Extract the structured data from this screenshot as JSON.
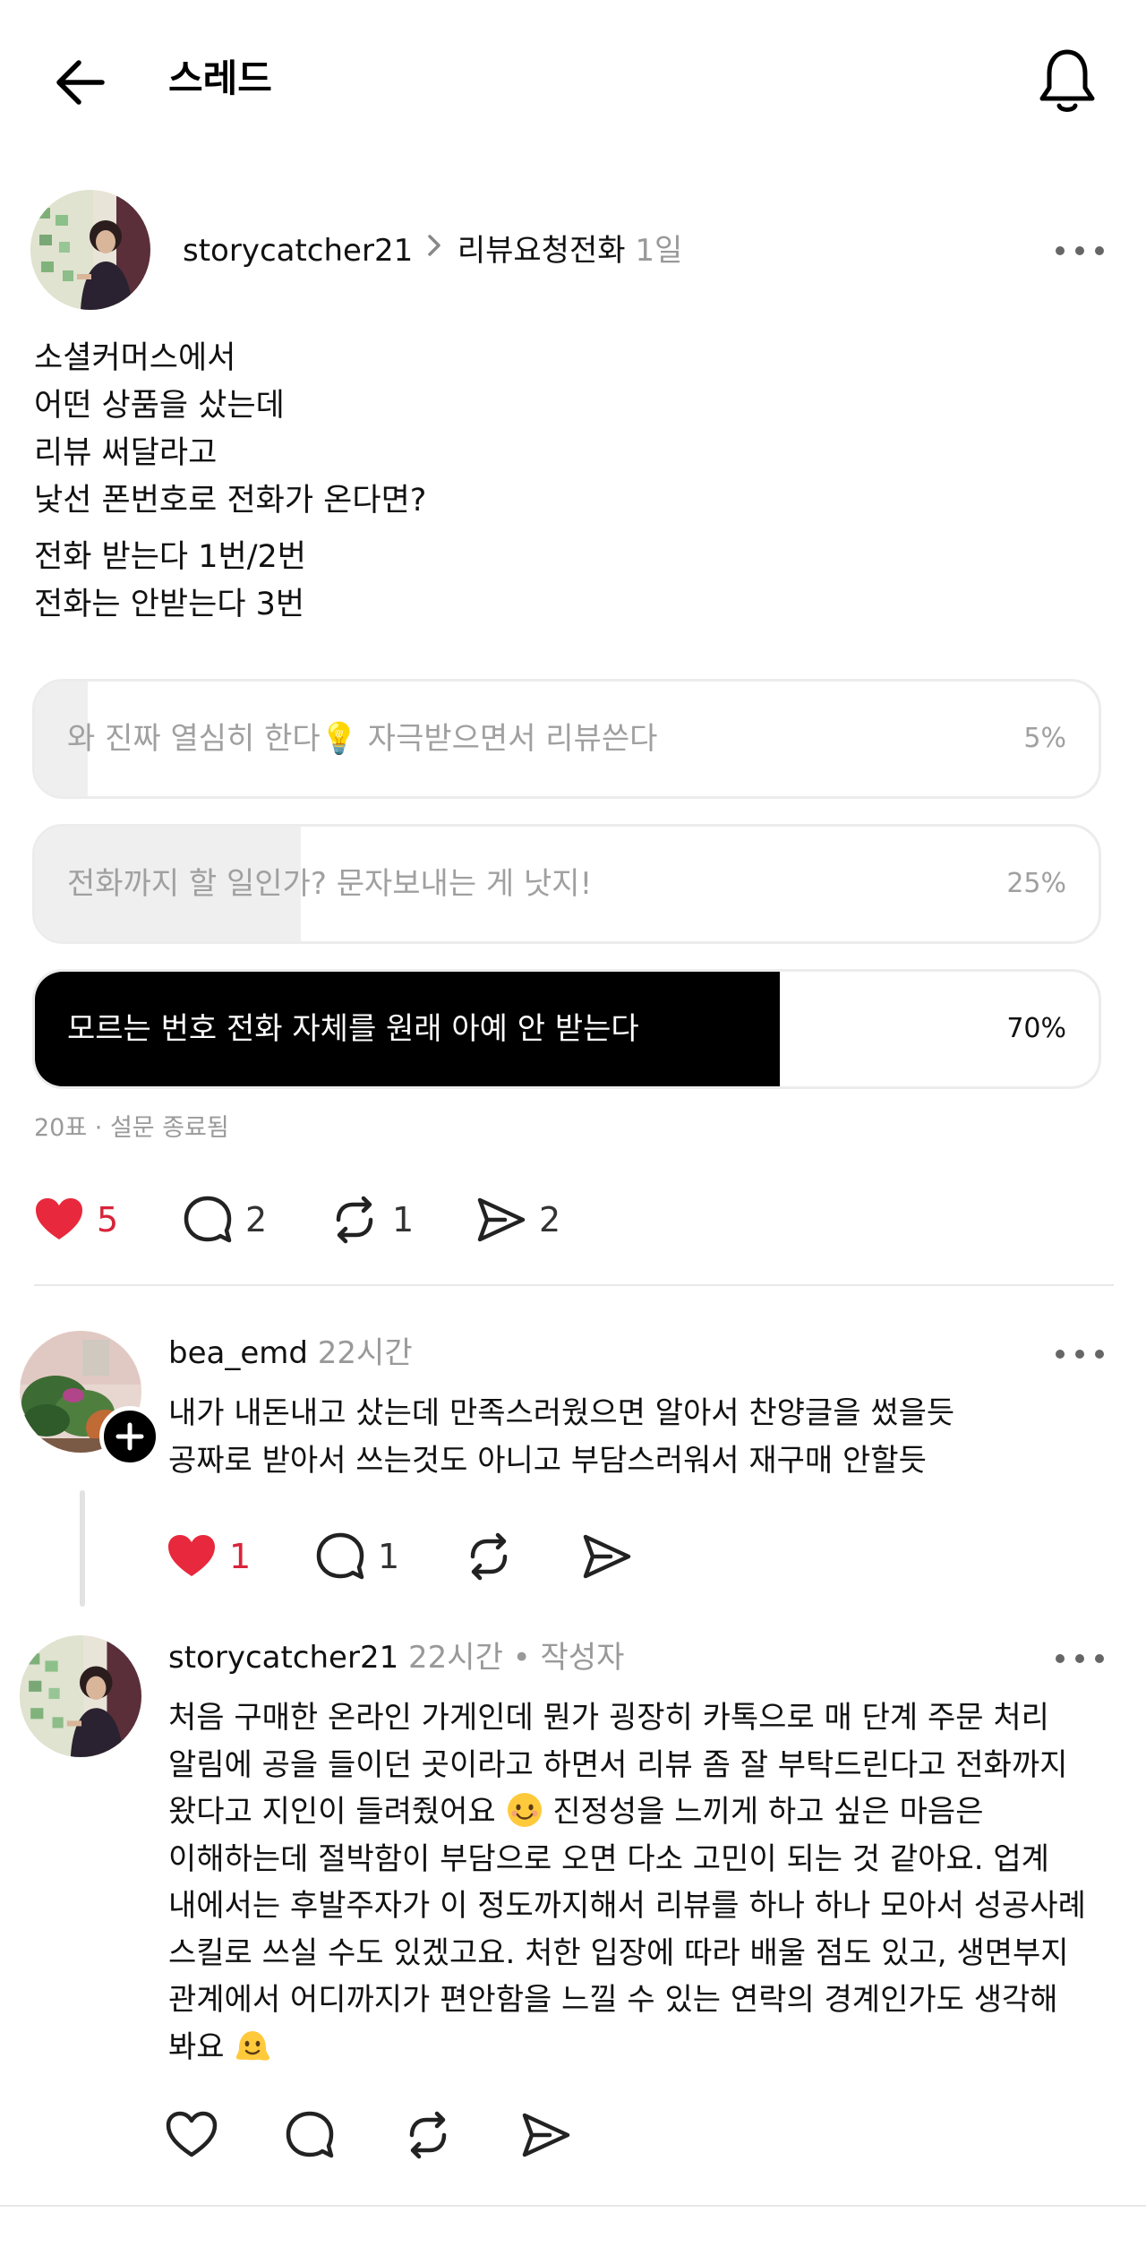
{
  "header": {
    "title": "스레드",
    "back_icon": "arrow-left-icon",
    "bell_icon": "bell-icon"
  },
  "post": {
    "author": "storycatcher21",
    "separator": ">",
    "topic": "리뷰요청전화",
    "time": "1일",
    "body_lines": [
      "소셜커머스에서",
      "어떤 상품을 샀는데",
      "리뷰 써달라고",
      "낯선 폰번호로 전화가 온다면?"
    ],
    "body_lines2": [
      "전화 받는다 1번/2번",
      "전화는 안받는다 3번"
    ],
    "poll": {
      "options": [
        {
          "label": "와 진짜 열심히 한다💡 자극받으면서 리뷰쓴다",
          "percent_label": "5%",
          "fraction": 0.05,
          "selected": false
        },
        {
          "label": "전화까지 할 일인가? 문자보내는 게 낫지!",
          "percent_label": "25%",
          "fraction": 0.25,
          "selected": false
        },
        {
          "label": "모르는 번호 전화 자체를 원래 아예 안 받는다",
          "percent_label": "70%",
          "fraction": 0.7,
          "selected": true
        }
      ],
      "summary": "20표 · 설문 종료됨"
    },
    "actions": {
      "likes": "5",
      "comments": "2",
      "reposts": "1",
      "shares": "2",
      "liked": true
    }
  },
  "replies": [
    {
      "author": "bea_emd",
      "time": "22시간",
      "lines": [
        "내가 내돈내고 샀는데 만족스러웠으면 알아서 찬양글을 썼을듯",
        "공짜로 받아서 쓰는것도 아니고 부담스러워서 재구매 안할듯"
      ],
      "likes": "1",
      "comments": "1",
      "liked": true
    },
    {
      "author": "storycatcher21",
      "time": "22시간",
      "author_badge": "• 작성자",
      "lines": [
        "처음 구매한 온라인 가게인데 뭔가 굉장히 카톡으로 매 단계 주문 처리",
        "알림에 공을 들이던 곳이라고 하면서 리뷰 좀 잘 부탁드린다고 전화까지",
        "왔다고 지인이 들려줬어요",
        "진정성을 느끼게 하고 싶은 마음은",
        "이해하는데 절박함이 부담으로 오면 다소 고민이 되는 것 같아요. 업계",
        "내에서는 후발주자가 이 정도까지해서 리뷰를 하나 하나 모아서 성공사례",
        "스킬로 쓰실 수도 있겠고요. 처한 입장에 따라 배울 점도 있고, 생면부지",
        "관계에서 어디까지가 편안함을 느낄 수 있는 연락의 경계인가도 생각해",
        "봐요"
      ],
      "emojis": [
        "smiling-face-icon",
        "melting-face-icon"
      ],
      "liked": false
    }
  ],
  "colors": {
    "like_red": "#e8283c",
    "selected_fill": "#000000",
    "muted_text": "#999999"
  }
}
